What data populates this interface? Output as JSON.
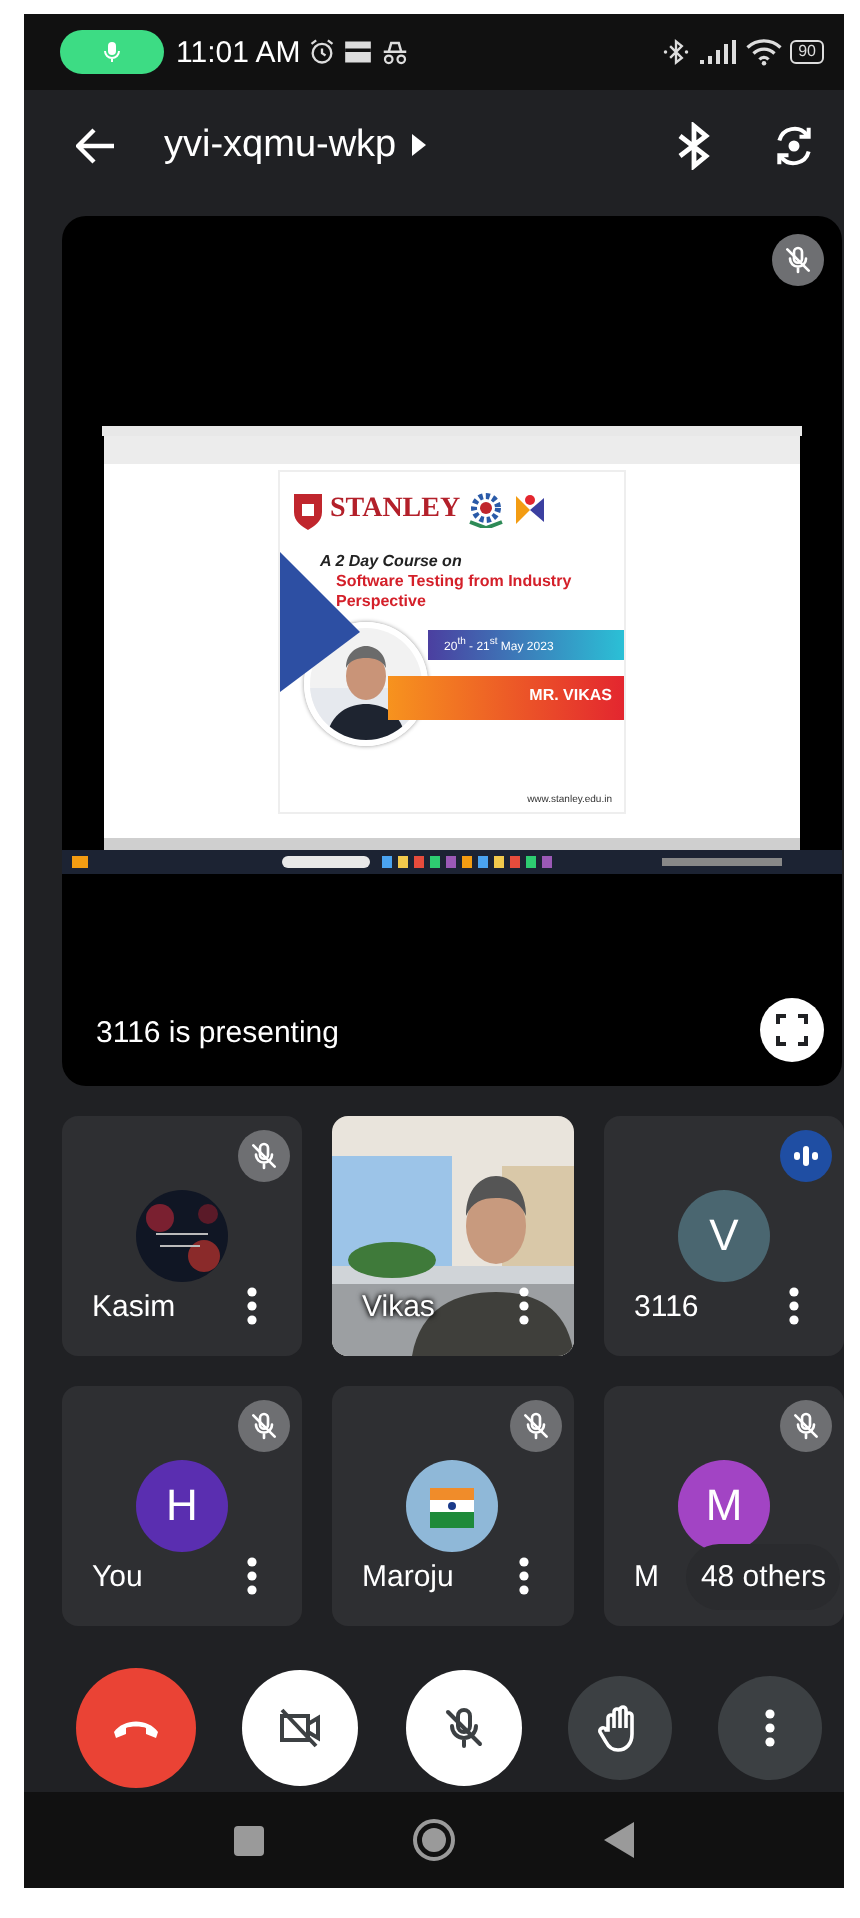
{
  "status_bar": {
    "time": "11:01 AM",
    "battery": "90"
  },
  "header": {
    "meeting_code": "yvi-xqmu-wkp"
  },
  "presentation": {
    "muted": true,
    "presenter_label": "3116 is presenting",
    "slide": {
      "logo_text": "STANLEY",
      "heading": "A 2 Day Course on",
      "title": "Software Testing from Industry Perspective",
      "date": "20$^{th}$ - 21$^{st}$ May 2023",
      "speaker": "MR. VIKAS",
      "website": "www.stanley.edu.in"
    }
  },
  "participants": [
    {
      "name": "Kasim",
      "kind": "picture",
      "muted": true,
      "speaking": false
    },
    {
      "name": "Vikas",
      "kind": "video",
      "muted": false,
      "speaking": false
    },
    {
      "name": "3116",
      "kind": "initial",
      "initial": "V",
      "color": "#4a6670",
      "muted": false,
      "speaking": true
    },
    {
      "name": "You",
      "kind": "initial",
      "initial": "H",
      "color": "#5a2eb0",
      "muted": true,
      "speaking": false
    },
    {
      "name": "Maroju",
      "kind": "picture",
      "muted": true,
      "speaking": false
    },
    {
      "name": "M",
      "kind": "initial",
      "initial": "M",
      "color": "#a244c4",
      "muted": true,
      "speaking": false
    }
  ],
  "others_badge": "48 others",
  "controls": [
    {
      "kind": "hangup"
    },
    {
      "kind": "camera",
      "on": false
    },
    {
      "kind": "mic",
      "on": false
    },
    {
      "kind": "hand"
    },
    {
      "kind": "more"
    }
  ]
}
